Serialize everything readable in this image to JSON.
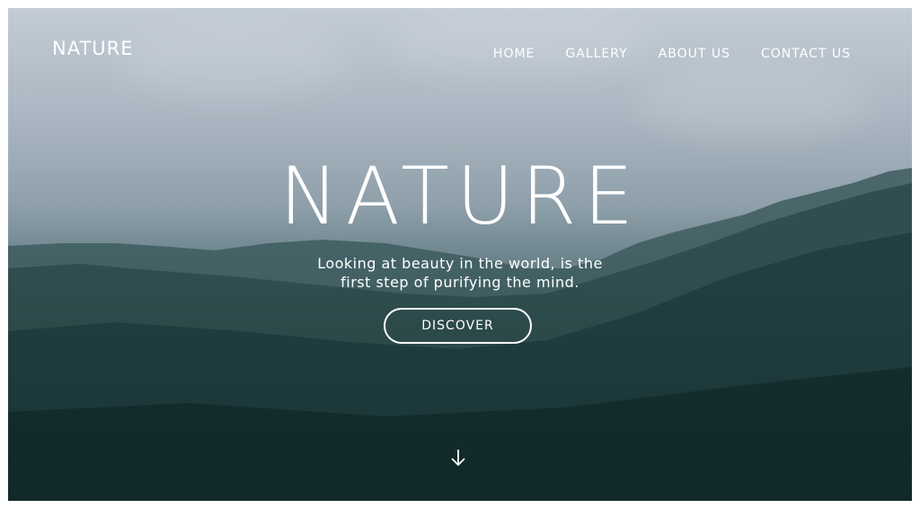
{
  "header": {
    "logo": "NATURE",
    "nav": [
      "HOME",
      "GALLERY",
      "ABOUT US",
      "CONTACT US"
    ]
  },
  "hero": {
    "title": "NATURE",
    "tagline_line1": "Looking at beauty in the world, is the",
    "tagline_line2": "first step of purifying the mind.",
    "button_label": "DISCOVER"
  },
  "icons": {
    "scroll": "arrow-down-icon"
  },
  "colors": {
    "text": "#ffffff",
    "sky": "#b8c3cd",
    "forest": "#1f3a3c"
  }
}
